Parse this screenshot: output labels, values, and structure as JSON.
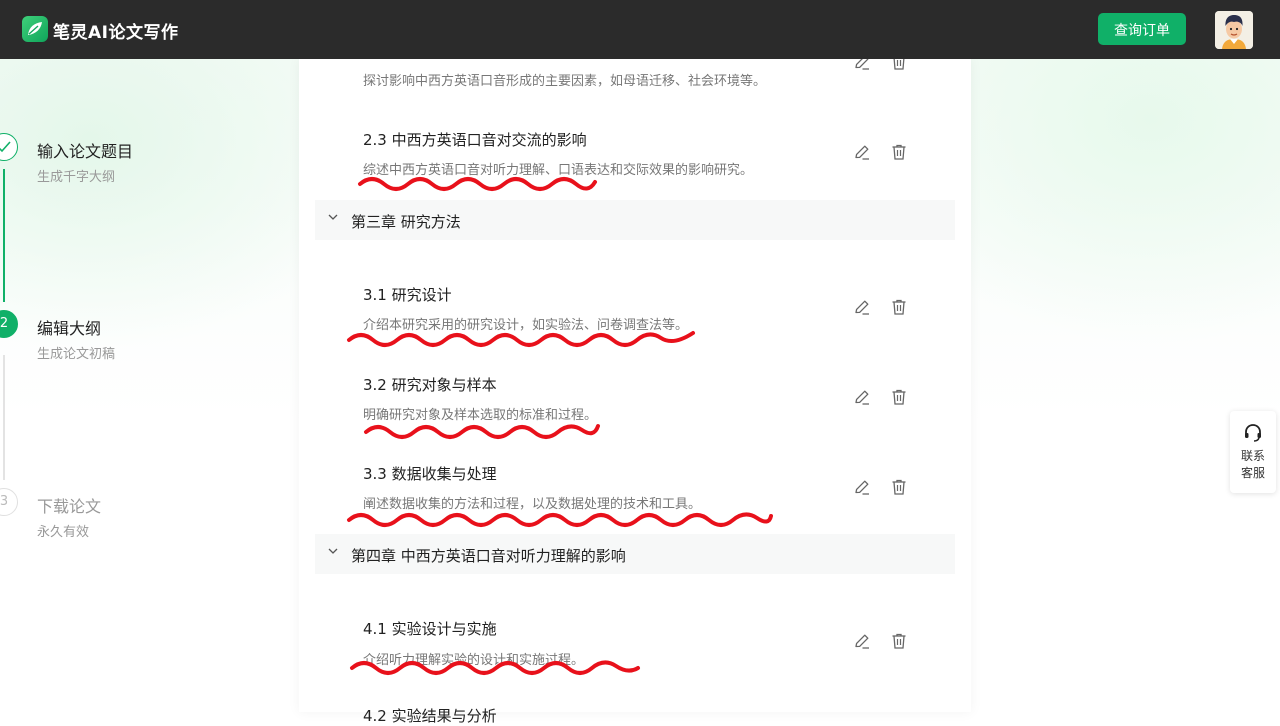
{
  "header": {
    "brand": "笔灵AI论文写作",
    "order_button": "查询订单"
  },
  "steps": [
    {
      "number": "✓",
      "title": "输入论文题目",
      "subtitle": "生成千字大纲",
      "state": "done"
    },
    {
      "number": "2",
      "title": "编辑大纲",
      "subtitle": "生成论文初稿",
      "state": "active"
    },
    {
      "number": "3",
      "title": "下载论文",
      "subtitle": "永久有效",
      "state": "pending"
    }
  ],
  "outline": {
    "partial_top_desc": "探讨影响中西方英语口音形成的主要因素，如母语迁移、社会环境等。",
    "sections": [
      {
        "title": "2.3 中西方英语口音对交流的影响",
        "desc": "综述中西方英语口音对听力理解、口语表达和交际效果的影响研究。"
      },
      {
        "title": "3.1 研究设计",
        "desc": "介绍本研究采用的研究设计，如实验法、问卷调查法等。"
      },
      {
        "title": "3.2 研究对象与样本",
        "desc": "明确研究对象及样本选取的标准和过程。"
      },
      {
        "title": "3.3 数据收集与处理",
        "desc": "阐述数据收集的方法和过程，以及数据处理的技术和工具。"
      },
      {
        "title": "4.1 实验设计与实施",
        "desc": "介绍听力理解实验的设计和实施过程。"
      },
      {
        "title": "4.2 实验结果与分析",
        "desc": ""
      }
    ],
    "chapters": [
      {
        "label": "第三章 研究方法"
      },
      {
        "label": "第四章 中西方英语口音对听力理解的影响"
      }
    ]
  },
  "icons": {
    "edit": "pencil-icon",
    "delete": "trash-icon",
    "collapse": "chevron-down-icon",
    "support": "headset-icon"
  },
  "contact": {
    "line1": "联系",
    "line2": "客服"
  },
  "colors": {
    "accent": "#10b068",
    "header_bg": "#2b2b2b",
    "annotation": "#e8111b"
  }
}
